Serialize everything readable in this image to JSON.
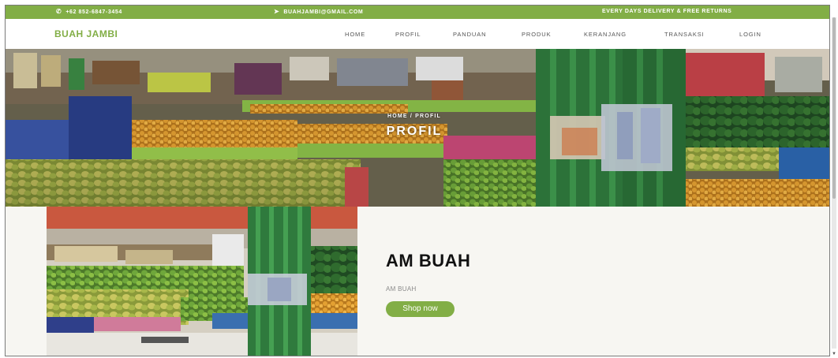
{
  "topbar": {
    "phone": "+62 852-6847-3454",
    "email": "BUAHJAMBI@GMAIL.COM",
    "promo": "EVERY DAYS DELIVERY & FREE RETURNS",
    "phone_icon": "phone-icon",
    "email_icon": "paper-plane-icon"
  },
  "nav": {
    "brand": "BUAH JAMBI",
    "items": [
      "HOME",
      "PROFIL",
      "PANDUAN",
      "PRODUK",
      "KERANJANG",
      "TRANSAKSI",
      "LOGIN"
    ]
  },
  "hero": {
    "breadcrumb": "HOME / PROFIL",
    "title": "PROFIL"
  },
  "product": {
    "title": "AM BUAH",
    "subtitle": "AM BUAH",
    "button_label": "Shop now"
  },
  "colors": {
    "accent": "#82ae46",
    "background": "#f7f6f2"
  }
}
